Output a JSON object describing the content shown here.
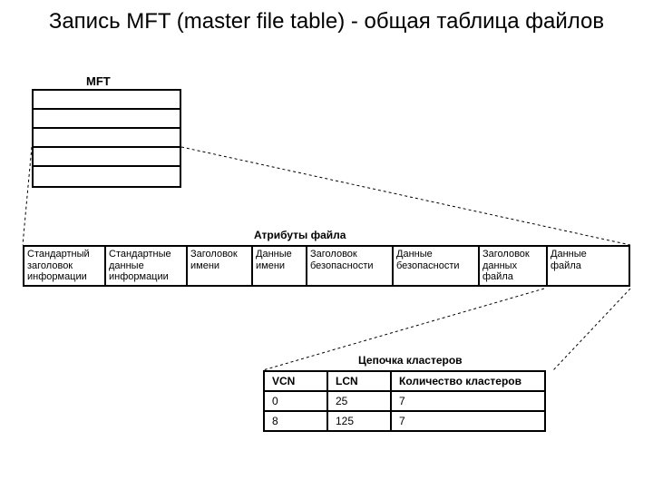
{
  "title": "Запись MFT (master file table) - общая таблица файлов",
  "mft": {
    "label": "MFT"
  },
  "attributes": {
    "label": "Атрибуты файла",
    "cells": [
      "Стандартный\nзаголовок\nинформации",
      "Стандартные\nданные\nинформации",
      "Заголовок\nимени",
      "Данные\nимени",
      "Заголовок\nбезопасности",
      "Данные\nбезопасности",
      "Заголовок\nданных\nфайла",
      "Данные\nфайла"
    ]
  },
  "chain": {
    "label": "Цепочка кластеров",
    "headers": [
      "VCN",
      "LCN",
      "Количество кластеров"
    ],
    "rows": [
      [
        "0",
        "25",
        "7"
      ],
      [
        "8",
        "125",
        "7"
      ]
    ]
  }
}
